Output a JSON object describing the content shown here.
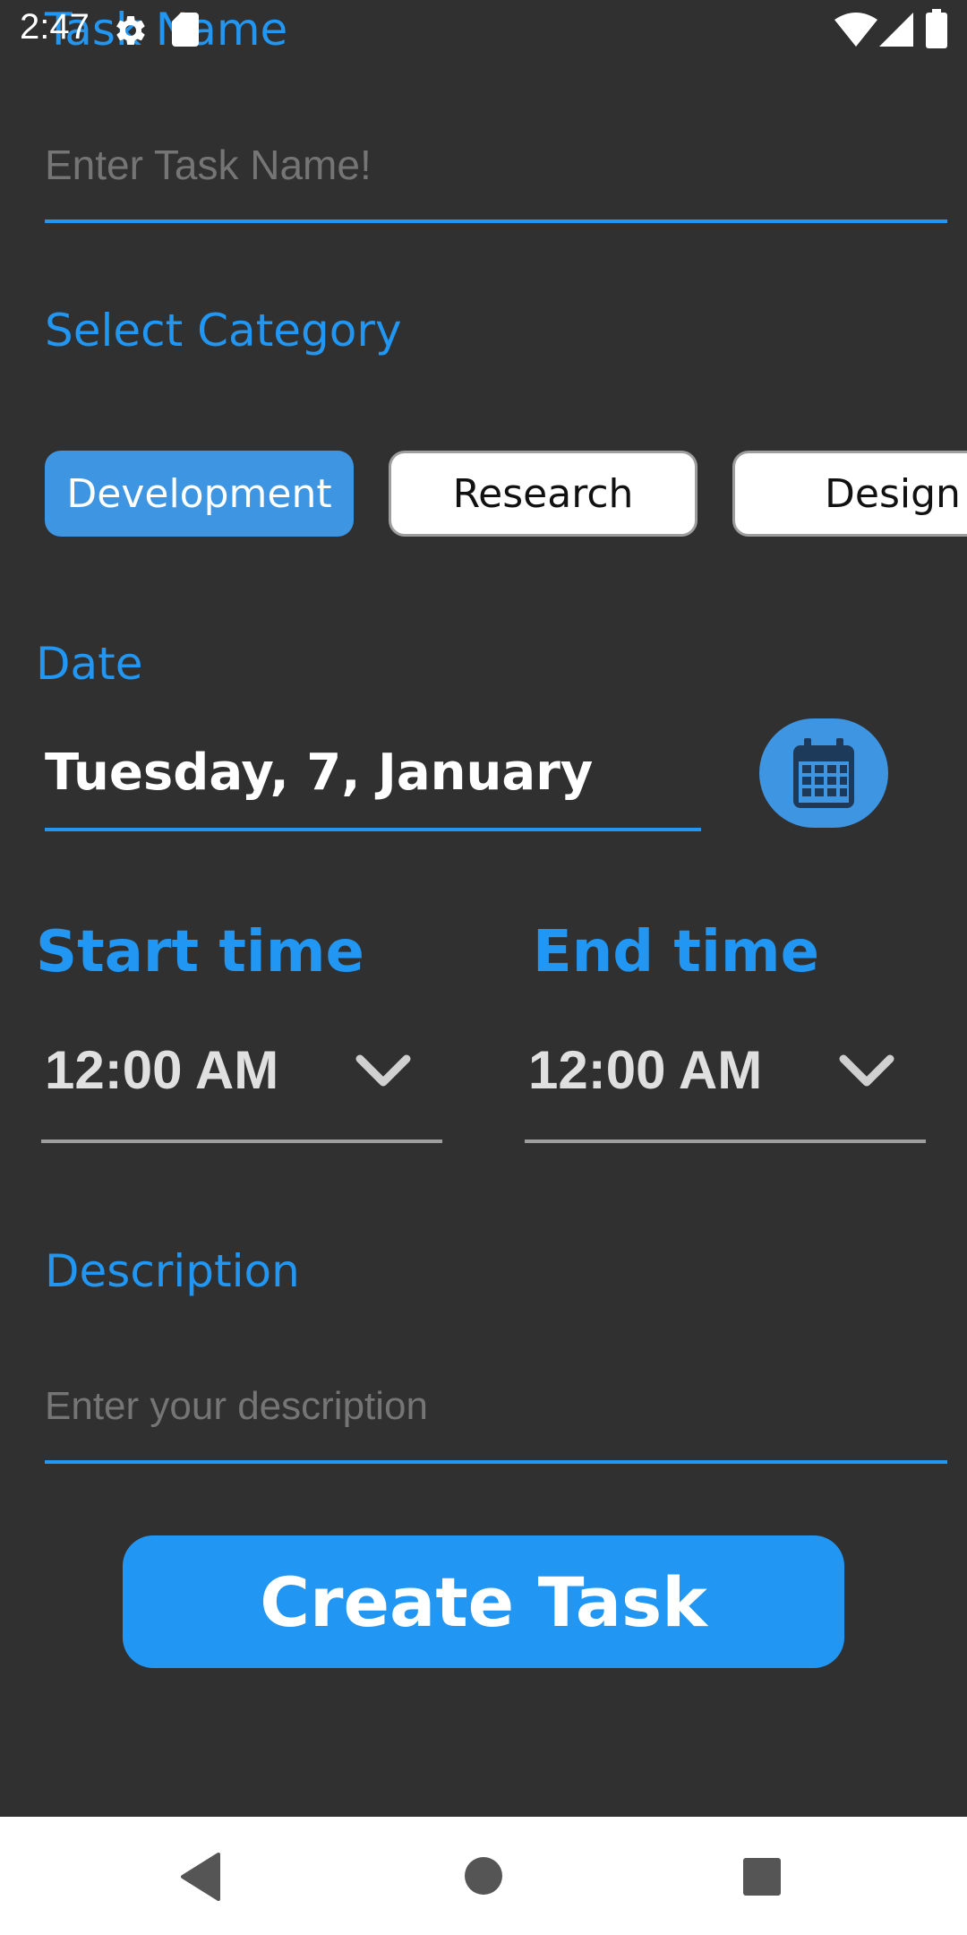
{
  "status_bar": {
    "time": "2:47",
    "icons": [
      "gear-icon",
      "sd-card-icon",
      "wifi-icon",
      "cellular-signal-icon",
      "battery-icon"
    ]
  },
  "form": {
    "task_name_label": "Task Name",
    "task_name_placeholder": "Enter Task Name!",
    "category_label": "Select Category",
    "categories": [
      {
        "label": "Development",
        "selected": true
      },
      {
        "label": "Research",
        "selected": false
      },
      {
        "label": "Design",
        "selected": false
      }
    ],
    "date_label": "Date",
    "date_value": "Tuesday, 7, January",
    "start_time_label": "Start time",
    "start_time_value": "12:00 AM",
    "end_time_label": "End time",
    "end_time_value": "12:00 AM",
    "description_label": "Description",
    "description_placeholder": "Enter your description",
    "create_button_label": "Create Task"
  },
  "nav_bar": {
    "icons": [
      "back-icon",
      "home-icon",
      "recents-icon"
    ]
  },
  "colors": {
    "background": "#303030",
    "accent": "#2196F3",
    "chip_selected": "#3E95E2",
    "nav_background": "#ffffff"
  }
}
